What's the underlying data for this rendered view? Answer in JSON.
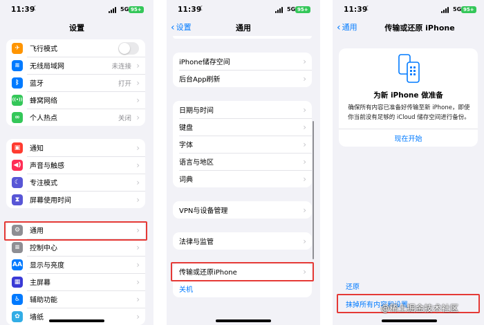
{
  "status": {
    "time": "11:39",
    "network": "5G",
    "battery": "95+"
  },
  "screen1": {
    "title": "设置",
    "group1": [
      {
        "label": "飞行模式",
        "icon": "airplane-icon",
        "color": "#ff9500",
        "glyph": "✈"
      },
      {
        "label": "无线局域网",
        "value": "未连接",
        "icon": "wifi-icon",
        "color": "#007aff",
        "glyph": "≋"
      },
      {
        "label": "蓝牙",
        "value": "打开",
        "icon": "bluetooth-icon",
        "color": "#007aff",
        "glyph": "ᛒ"
      },
      {
        "label": "蜂窝网络",
        "icon": "antenna-icon",
        "color": "#34c759",
        "glyph": "((•))"
      },
      {
        "label": "个人热点",
        "value": "关闭",
        "icon": "hotspot-icon",
        "color": "#34c759",
        "glyph": "∞"
      }
    ],
    "group2": [
      {
        "label": "通知",
        "icon": "notification-icon",
        "color": "#ff3b30",
        "glyph": "▣"
      },
      {
        "label": "声音与触感",
        "icon": "speaker-icon",
        "color": "#ff2d55",
        "glyph": "◀)"
      },
      {
        "label": "专注模式",
        "icon": "moon-icon",
        "color": "#5856d6",
        "glyph": "☾"
      },
      {
        "label": "屏幕使用时间",
        "icon": "hourglass-icon",
        "color": "#5856d6",
        "glyph": "⧗"
      }
    ],
    "group3": [
      {
        "label": "通用",
        "icon": "gear-icon",
        "color": "#8e8e93",
        "glyph": "⚙"
      },
      {
        "label": "控制中心",
        "icon": "toggles-icon",
        "color": "#8e8e93",
        "glyph": "≡"
      },
      {
        "label": "显示与亮度",
        "icon": "brightness-icon",
        "color": "#007aff",
        "glyph": "AA"
      },
      {
        "label": "主屏幕",
        "icon": "grid-icon",
        "color": "#3a3ad6",
        "glyph": "▦"
      },
      {
        "label": "辅助功能",
        "icon": "accessibility-icon",
        "color": "#007aff",
        "glyph": "♿"
      },
      {
        "label": "墙纸",
        "icon": "wallpaper-icon",
        "color": "#32ade6",
        "glyph": "✿"
      }
    ]
  },
  "screen2": {
    "back": "设置",
    "title": "通用",
    "group1": [
      "iPhone储存空间",
      "后台App刷新"
    ],
    "group2": [
      "日期与时间",
      "键盘",
      "字体",
      "语言与地区",
      "词典"
    ],
    "group3": [
      "VPN与设备管理"
    ],
    "group4": [
      "法律与监管"
    ],
    "group5": [
      "传输或还原iPhone",
      "关机"
    ]
  },
  "screen3": {
    "back": "通用",
    "title": "传输或还原 iPhone",
    "card_heading": "为新 iPhone 做准备",
    "card_desc": "确保所有内容已准备好传输至新 iPhone，即使你当前没有足够的 iCloud 储存空间进行备份。",
    "card_action": "现在开始",
    "reset": "还原",
    "erase": "抹掉所有内容和设置",
    "watermark": "@稀土掘金技术社区"
  },
  "colors": {
    "accent": "#007aff",
    "highlight": "#e53935",
    "background": "#f2f2f7"
  }
}
